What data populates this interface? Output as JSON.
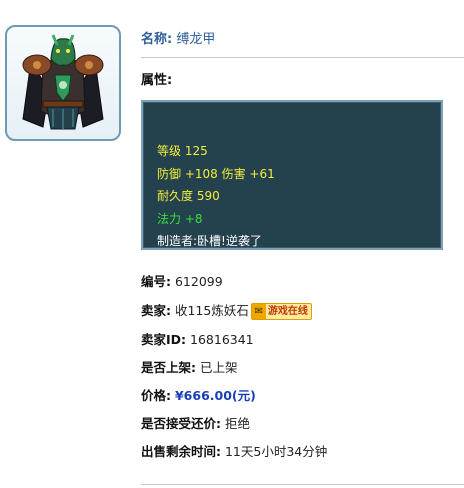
{
  "item": {
    "name_label": "名称:",
    "name": "缚龙甲",
    "attributes_label": "属性:",
    "image_icon": "armor-item-icon"
  },
  "stats": [
    {
      "text": "等级 125",
      "color": "#f3ee3a"
    },
    {
      "text": "防御 +108 伤害 +61",
      "color": "#f3ee3a"
    },
    {
      "text": "耐久度 590",
      "color": "#f3ee3a"
    },
    {
      "text": "法力 +8",
      "color": "#38e038"
    },
    {
      "text": "制造者:卧槽!逆袭了",
      "color": "#ffffff"
    }
  ],
  "details": {
    "serial_label": "编号:",
    "serial": "612099",
    "seller_label": "卖家:",
    "seller": "收115炼妖石",
    "seller_badge_icon": "game-online-icon",
    "seller_badge": "游戏在线",
    "seller_id_label": "卖家ID:",
    "seller_id": "16816341",
    "listed_label": "是否上架:",
    "listed": "已上架",
    "price_label": "价格:",
    "price": "¥666.00(元)",
    "counter_offer_label": "是否接受还价:",
    "counter_offer": "拒绝",
    "time_left_label": "出售剩余时间:",
    "time_left": "11天5小时34分钟"
  },
  "colors": {
    "stats_bg": "#24414e",
    "stat_yellow": "#f3ee3a",
    "stat_green": "#38e038",
    "price_blue": "#1a3fb5",
    "name_blue": "#2f5f9a"
  }
}
